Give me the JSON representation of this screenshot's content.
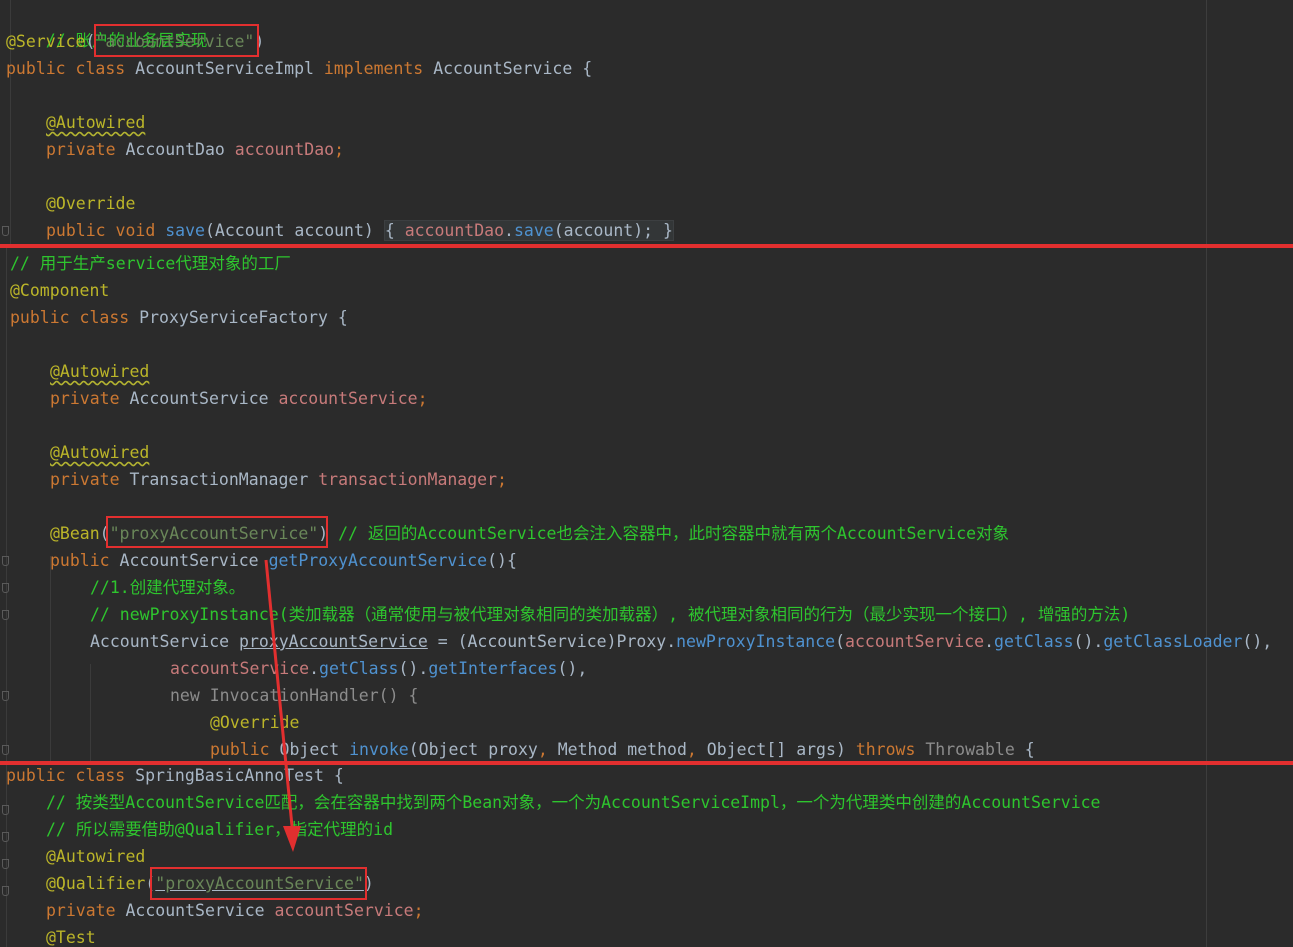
{
  "panel_account_impl": {
    "l1": "// 账户的业务层实现",
    "l2_annot": "@Service",
    "l2_paren_open": "(",
    "l2_str": "\"accountService\"",
    "l2_paren_close": ")",
    "l3_kw1": "public",
    "l3_kw2": "class",
    "l3_name": "AccountServiceImpl",
    "l3_impl": "implements",
    "l3_iface": "AccountService",
    "l3_brace": "{",
    "l5_annot": "@Autowired",
    "l6_kw": "private",
    "l6_type": "AccountDao",
    "l6_field": "accountDao",
    "l6_semi": ";",
    "l8_annot": "@Override",
    "l9_kw1": "public",
    "l9_kw2": "void",
    "l9_method": "save",
    "l9_params": "(Account account)",
    "l9_open": "{",
    "l9_field": "accountDao",
    "l9_dot": ".",
    "l9_call": "save",
    "l9_args": "(account);",
    "l9_close": "}"
  },
  "panel_proxy_factory": {
    "l1": "// 用于生产service代理对象的工厂",
    "l2_annot": "@Component",
    "l3_kw1": "public",
    "l3_kw2": "class",
    "l3_name": "ProxyServiceFactory",
    "l3_brace": "{",
    "l5_annot": "@Autowired",
    "l6_kw": "private",
    "l6_type": "AccountService",
    "l6_field": "accountService",
    "l6_semi": ";",
    "l8_annot": "@Autowired",
    "l9_kw": "private",
    "l9_type": "TransactionManager",
    "l9_field": "transactionManager",
    "l9_semi": ";",
    "l11_annot": "@Bean",
    "l11_paren_open": "(",
    "l11_str": "\"proxyAccountService\"",
    "l11_paren_close": ")",
    "l11_comment": "// 返回的AccountService也会注入容器中，此时容器中就有两个AccountService对象",
    "l12_kw": "public",
    "l12_type": "AccountService",
    "l12_method": "getProxyAccountService",
    "l12_rest": "(){",
    "l13": "//1.创建代理对象。",
    "l14": "// newProxyInstance(类加载器（通常使用与被代理对象相同的类加载器）, 被代理对象相同的行为（最少实现一个接口）, 增强的方法)",
    "l15_type": "AccountService",
    "l15_var": "proxyAccountService",
    "l15_eq": " = (AccountService)",
    "l15_proxy": "Proxy",
    "l15_dot1": ".",
    "l15_m1": "newProxyInstance",
    "l15_p1": "(",
    "l15_field": "accountService",
    "l15_dot2": ".",
    "l15_m2": "getClass",
    "l15_p2": "().",
    "l15_m3": "getClassLoader",
    "l15_p3": "(),",
    "l16_field": "accountService",
    "l16_dot": ".",
    "l16_m1": "getClass",
    "l16_p1": "().",
    "l16_m2": "getInterfaces",
    "l16_p2": "(),",
    "l17_kw": "new",
    "l17_type": "InvocationHandler",
    "l17_rest": "() {",
    "l18_annot": "@Override",
    "l19_kw": "public",
    "l19_type1": "Object",
    "l19_method": "invoke",
    "l19_p_open": "(",
    "l19_type2": "Object",
    "l19_arg1": "proxy",
    "l19_comma1": ",",
    "l19_type3": "Method",
    "l19_arg2": "method",
    "l19_comma2": ",",
    "l19_type4": "Object[]",
    "l19_arg3": "args",
    "l19_p_close": ")",
    "l19_throws": "throws",
    "l19_exc": "Throwable",
    "l19_brace": "{"
  },
  "panel_test": {
    "l1_kw1": "public",
    "l1_kw2": "class",
    "l1_name": "SpringBasicAnnoTest",
    "l1_brace": "{",
    "l2": "// 按类型AccountService匹配，会在容器中找到两个Bean对象，一个为AccountServiceImpl，一个为代理类中创建的AccountService",
    "l3": "// 所以需要借助@Qualifier，指定代理的id",
    "l4_annot": "@Autowired",
    "l5_annot": "@Qualifier",
    "l5_paren_open": "(",
    "l5_str": "\"proxyAccountService\"",
    "l5_paren_close": ")",
    "l6_kw": "private",
    "l6_type": "AccountService",
    "l6_field": "accountService",
    "l6_semi": ";",
    "l7_annot": "@Test"
  },
  "colors": {
    "background": "#2b2b2b",
    "keyword": "#cc7832",
    "string": "#6a8759",
    "annotation": "#bbb529",
    "comment": "#2ec52e",
    "field": "#c77a7a",
    "method": "#4f92d0",
    "highlight": "#e22f2f"
  },
  "icons": [
    "fold-marker-icon",
    "arrow-icon"
  ]
}
